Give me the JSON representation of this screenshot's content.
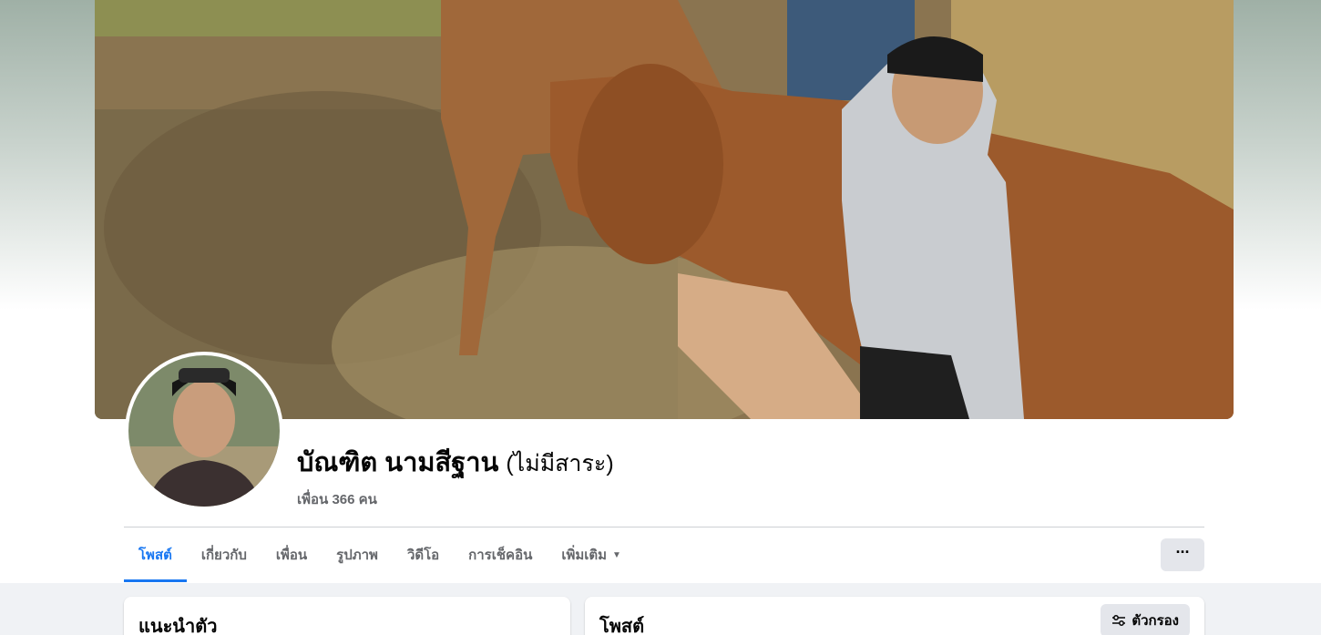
{
  "profile": {
    "name": "บัณฑิต นามสีฐาน",
    "alt_name": "(ไม่มีสาระ)",
    "friends": "เพื่อน 366 คน"
  },
  "tabs": [
    {
      "label": "โพสต์",
      "active": true
    },
    {
      "label": "เกี่ยวกับ",
      "active": false
    },
    {
      "label": "เพื่อน",
      "active": false
    },
    {
      "label": "รูปภาพ",
      "active": false
    },
    {
      "label": "วิดีโอ",
      "active": false
    },
    {
      "label": "การเช็คอิน",
      "active": false
    },
    {
      "label": "เพิ่มเติม",
      "active": false
    }
  ],
  "more_button": {
    "label": "···"
  },
  "intro_card": {
    "title": "แนะนำตัว"
  },
  "posts_card": {
    "title": "โพสต์",
    "filter_label": "ตัวกรอง"
  },
  "colors": {
    "accent": "#1877f2",
    "secondary_text": "#65676b",
    "button_bg": "#e4e6eb"
  }
}
